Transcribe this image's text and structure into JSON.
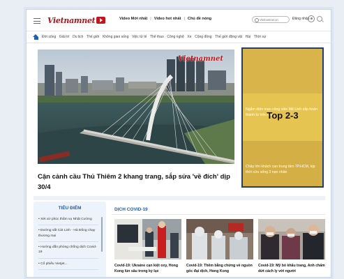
{
  "header": {
    "logo_text": "Vietnamnet",
    "links": [
      "Video Mới nhất",
      "Video hot nhất",
      "Chủ đề nóng"
    ],
    "search_placeholder": "Vietnamnet.vn",
    "login_label": "Đăng nhập"
  },
  "nav": {
    "items": [
      "Đời sống",
      "Giải trí",
      "Du lịch",
      "Thế giới",
      "Không gian sống",
      "Việc tử tế",
      "Thể thao",
      "Công nghệ",
      "Xe",
      "Cộng đồng",
      "Thế giới động vật",
      "Hài",
      "Thời sự"
    ]
  },
  "hero": {
    "watermark": "Vietnamnet",
    "headline": "Cận cảnh cầu Thủ Thiêm 2 khang trang, sắp sửa 'về đích' dịp 30/4"
  },
  "ad": {
    "label": "Top 2-3",
    "text_top": "Ngắm diện mạo công viên Mê Linh sắp hoàn thành từ trên cao",
    "text_bottom": "Chảy lớn khách can trung tâm TP.HCM, kịp thời cứu sống 3 nạn nhân"
  },
  "focus": {
    "title": "TIÊU ĐIỂM",
    "items": [
      "Xét xử phúc thẩm vụ Nhật Cường",
      "Đường sắt Cát Linh - Hà Đông chạy thương mại",
      "Hướng dẫn phòng chống dịch Covid-19",
      "Cổ phiếu Vietjet..."
    ]
  },
  "covid": {
    "title": "DỊCH COVID-19",
    "articles": [
      "Covid-19: Ukraine cạn kiệt oxy, Hong Kong lún sâu trong kỷ lục",
      "Covid-19: Thêm bằng chứng về nguồn gốc đại dịch, Hong Kong",
      "Covid-19: Mỹ bỏ khẩu trang, Anh chấm dứt cách ly với người"
    ]
  },
  "colors": {
    "brand_red": "#c2161e",
    "link_blue": "#1f5fb5",
    "ad_yellow": "#e6c452",
    "ad_border": "#1f3f6e"
  }
}
